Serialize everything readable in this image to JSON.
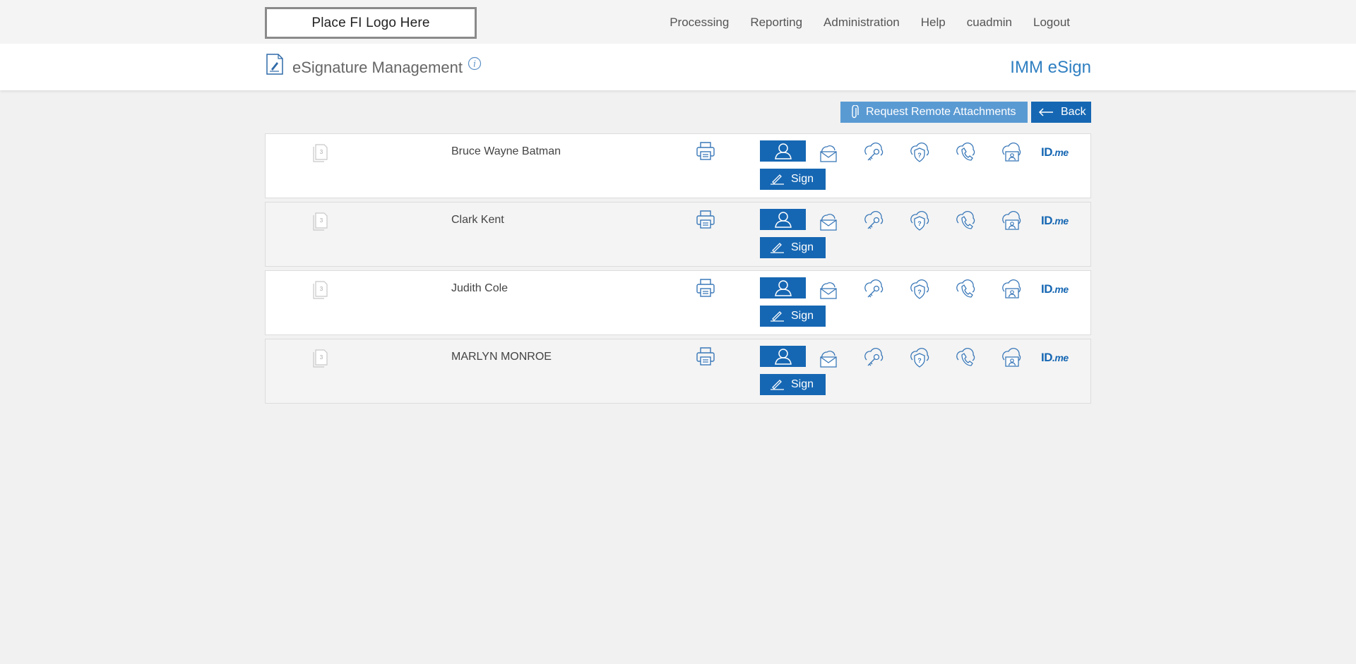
{
  "logo": {
    "text": "Place FI Logo Here"
  },
  "nav": {
    "items": [
      "Processing",
      "Reporting",
      "Administration",
      "Help",
      "cuadmin",
      "Logout"
    ]
  },
  "header": {
    "title": "eSignature Management",
    "brand": "IMM eSign"
  },
  "actions": {
    "attach_label": "Request Remote Attachments",
    "back_label": "Back"
  },
  "rows": [
    {
      "name": "Bruce Wayne Batman",
      "doc_count": "3",
      "sign_label": "Sign",
      "idme_id": "ID",
      "idme_me": ".me"
    },
    {
      "name": "Clark Kent",
      "doc_count": "3",
      "sign_label": "Sign",
      "idme_id": "ID",
      "idme_me": ".me"
    },
    {
      "name": "Judith Cole",
      "doc_count": "3",
      "sign_label": "Sign",
      "idme_id": "ID",
      "idme_me": ".me"
    },
    {
      "name": "MARLYN MONROE",
      "doc_count": "3",
      "sign_label": "Sign",
      "idme_id": "ID",
      "idme_me": ".me"
    }
  ],
  "icons": {
    "document": "document-edit-icon",
    "info": "info-icon",
    "attach": "paperclip-icon",
    "back": "arrow-left-icon",
    "copy": "document-copies-icon",
    "print": "printer-icon",
    "signer": "person-icon",
    "email": "cloud-email-icon",
    "key": "cloud-key-icon",
    "question": "cloud-shield-question-icon",
    "phone": "cloud-phone-icon",
    "idcard": "cloud-id-card-icon",
    "pen": "pen-icon"
  },
  "colors": {
    "primary": "#1667b3",
    "secondary": "#5a9ad3",
    "brand_text": "#2f7fc1",
    "background": "#f1f1f1"
  }
}
